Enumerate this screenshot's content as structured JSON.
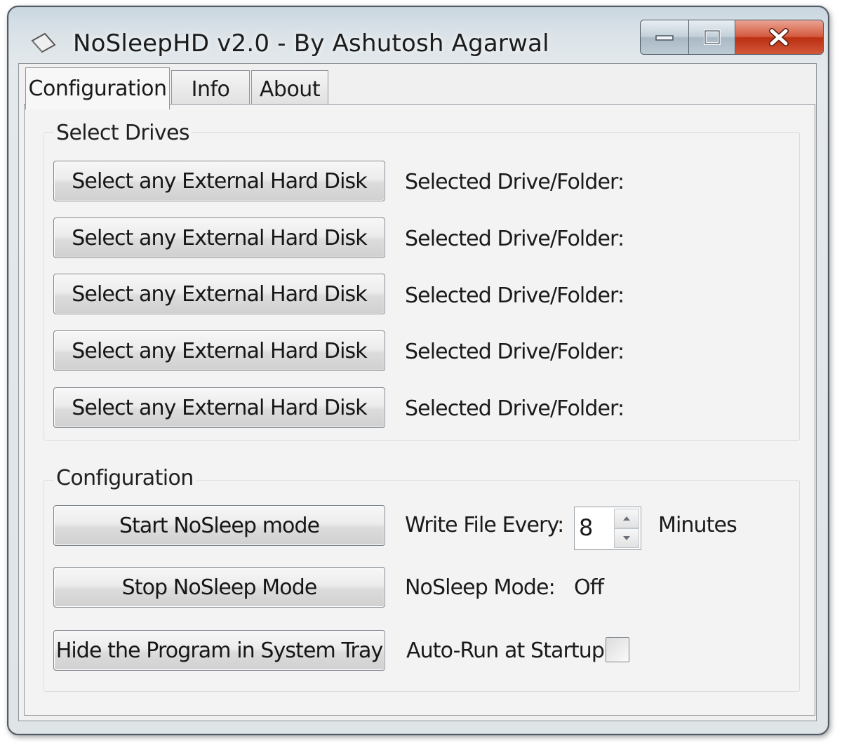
{
  "window": {
    "title": "NoSleepHD v2.0 - By Ashutosh Agarwal"
  },
  "tabs": [
    {
      "label": "Configuration",
      "active": true
    },
    {
      "label": "Info",
      "active": false
    },
    {
      "label": "About",
      "active": false
    }
  ],
  "select_drives": {
    "group_label": "Select Drives",
    "rows": [
      {
        "button_label": "Select any External Hard Disk",
        "status_label": "Selected Drive/Folder:"
      },
      {
        "button_label": "Select any External Hard Disk",
        "status_label": "Selected Drive/Folder:"
      },
      {
        "button_label": "Select any External Hard Disk",
        "status_label": "Selected Drive/Folder:"
      },
      {
        "button_label": "Select any External Hard Disk",
        "status_label": "Selected Drive/Folder:"
      },
      {
        "button_label": "Select any External Hard Disk",
        "status_label": "Selected Drive/Folder:"
      }
    ]
  },
  "configuration": {
    "group_label": "Configuration",
    "start_button": "Start NoSleep mode",
    "stop_button": "Stop NoSleep Mode",
    "hide_button": "Hide the Program in System Tray",
    "write_file_label": "Write File Every:",
    "write_file_value": "8",
    "write_file_unit": "Minutes",
    "mode_label": "NoSleep Mode:",
    "mode_value": "Off",
    "autorun_label": "Auto-Run at Startup",
    "autorun_checked": false
  },
  "colors": {
    "close_button": "#c8462b",
    "window_frame": "#c9d7e0",
    "panel": "#f0f0f0"
  }
}
